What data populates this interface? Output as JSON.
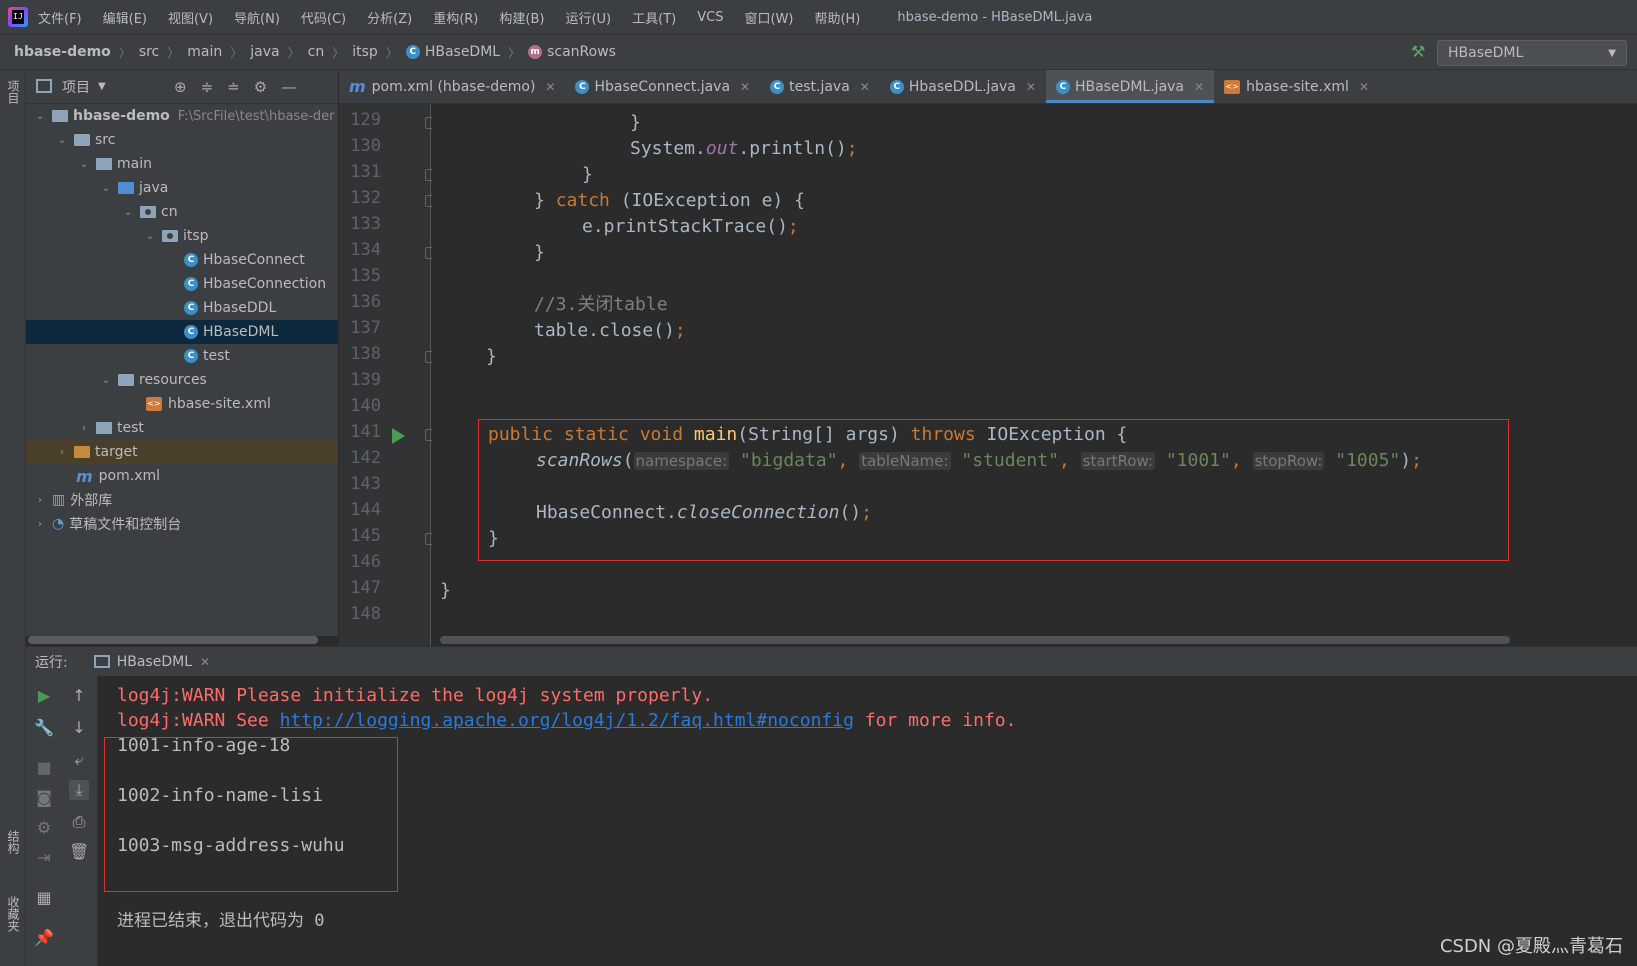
{
  "app": {
    "window_title": "hbase-demo - HBaseDML.java",
    "menu": [
      "文件(F)",
      "编辑(E)",
      "视图(V)",
      "导航(N)",
      "代码(C)",
      "分析(Z)",
      "重构(R)",
      "构建(B)",
      "运行(U)",
      "工具(T)",
      "VCS",
      "窗口(W)",
      "帮助(H)"
    ]
  },
  "breadcrumb": [
    "hbase-demo",
    "src",
    "main",
    "java",
    "cn",
    "itsp",
    "HBaseDML",
    "scanRows"
  ],
  "run_config": "HBaseDML",
  "left_strip": {
    "project": "项目",
    "structure": "结构",
    "favorites": "收藏夹"
  },
  "project": {
    "header": "项目",
    "tree": [
      {
        "label": "hbase-demo",
        "path": "F:\\SrcFile\\test\\hbase-der"
      },
      {
        "label": "src"
      },
      {
        "label": "main"
      },
      {
        "label": "java"
      },
      {
        "label": "cn"
      },
      {
        "label": "itsp"
      },
      {
        "label": "HbaseConnect"
      },
      {
        "label": "HbaseConnection"
      },
      {
        "label": "HbaseDDL"
      },
      {
        "label": "HBaseDML"
      },
      {
        "label": "test"
      },
      {
        "label": "resources"
      },
      {
        "label": "hbase-site.xml"
      },
      {
        "label": "test"
      },
      {
        "label": "target"
      },
      {
        "label": "pom.xml"
      },
      {
        "label": "外部库"
      },
      {
        "label": "草稿文件和控制台"
      }
    ]
  },
  "tabs": [
    {
      "label": "pom.xml (hbase-demo)"
    },
    {
      "label": "HbaseConnect.java"
    },
    {
      "label": "test.java"
    },
    {
      "label": "HbaseDDL.java"
    },
    {
      "label": "HBaseDML.java",
      "active": true
    },
    {
      "label": "hbase-site.xml"
    }
  ],
  "editor": {
    "line_numbers": [
      "129",
      "130",
      "131",
      "132",
      "133",
      "134",
      "135",
      "136",
      "137",
      "138",
      "139",
      "140",
      "141",
      "142",
      "143",
      "144",
      "145",
      "146",
      "147",
      "148"
    ],
    "code": {
      "l129": "}",
      "l130_a": "System.",
      "l130_b": "out",
      "l130_c": ".println()",
      "l130_d": ";",
      "l131": "}",
      "l132_a": "} ",
      "l132_b": "catch",
      "l132_c": " (IOException e) {",
      "l133_a": "e.printStackTrace()",
      "l133_b": ";",
      "l134": "}",
      "l136": "//3.关闭table",
      "l137_a": "table.close()",
      "l137_b": ";",
      "l138": "}",
      "l141_a": "public static void ",
      "l141_b": "main",
      "l141_c": "(String[] args) ",
      "l141_d": "throws ",
      "l141_e": "IOException {",
      "l142_a": "scanRows",
      "l142_b": "(",
      "l142_h1": "namespace:",
      "l142_s1": "\"bigdata\"",
      "l142_c1": ",",
      "l142_h2": "tableName:",
      "l142_s2": "\"student\"",
      "l142_c2": ",",
      "l142_h3": "startRow:",
      "l142_s3": "\"1001\"",
      "l142_c3": ",",
      "l142_h4": "stopRow:",
      "l142_s4": "\"1005\"",
      "l142_e": ")",
      "l142_f": ";",
      "l144_a": "HbaseConnect.",
      "l144_b": "closeConnection",
      "l144_c": "()",
      "l144_d": ";",
      "l145": "}",
      "l147": "}"
    }
  },
  "run_panel": {
    "label": "运行:",
    "tab": "HBaseDML",
    "console": {
      "warn1": "log4j:WARN Please initialize the log4j system properly.",
      "warn2_a": "log4j:WARN See ",
      "warn2_link": "http://logging.apache.org/log4j/1.2/faq.html#noconfig",
      "warn2_b": " for more info.",
      "out1": "1001-info-age-18",
      "out2": "1002-info-name-lisi",
      "out3": "1003-msg-address-wuhu",
      "exit": "进程已结束，退出代码为 0"
    }
  },
  "watermark": "CSDN @夏殿灬青葛石"
}
